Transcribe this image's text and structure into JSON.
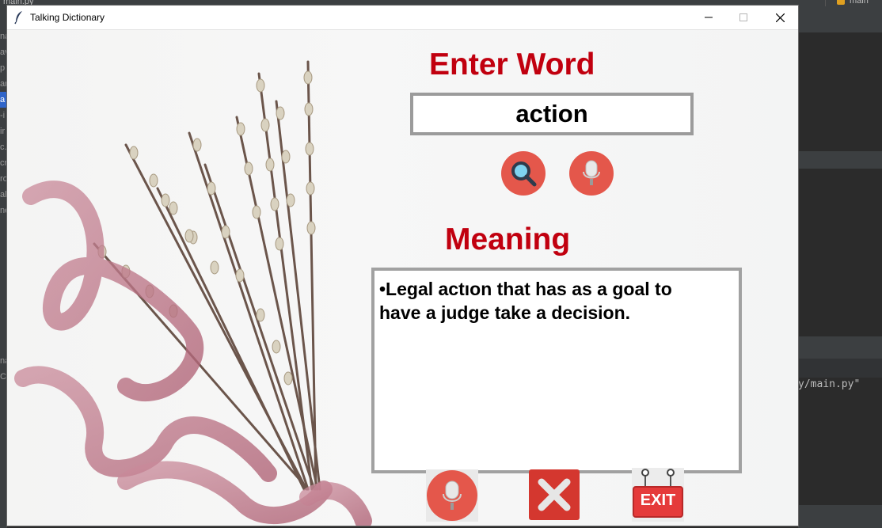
{
  "ide": {
    "file_tab": "main.py",
    "branch": "main",
    "console_line": "y/main.py\"",
    "left_gutter": [
      "na",
      "av",
      "p",
      "ar",
      "a",
      "-i",
      "ir",
      "c.",
      "cr",
      "ro",
      "al",
      "ne"
    ],
    "left_bottom": [
      "na",
      "C"
    ]
  },
  "window": {
    "title": "Talking Dictionary",
    "controls": {
      "minimize": "—",
      "maximize": "☐",
      "close": "✕"
    }
  },
  "app": {
    "enter_word_label": "Enter Word",
    "word_value": "action",
    "meaning_label": "Meaning",
    "meaning_text": "•Legal actıon that has as a goal to\nhave a judge take a decision.",
    "exit_label": "EXIT",
    "icons": {
      "search": "magnifier-icon",
      "mic": "microphone-icon",
      "clear": "x-icon",
      "exit": "exit-sign-icon"
    },
    "colors": {
      "heading": "#c1000f",
      "button_red": "#e4574b",
      "clear_red": "#d4372f",
      "box_border": "#a1a1a1"
    }
  }
}
